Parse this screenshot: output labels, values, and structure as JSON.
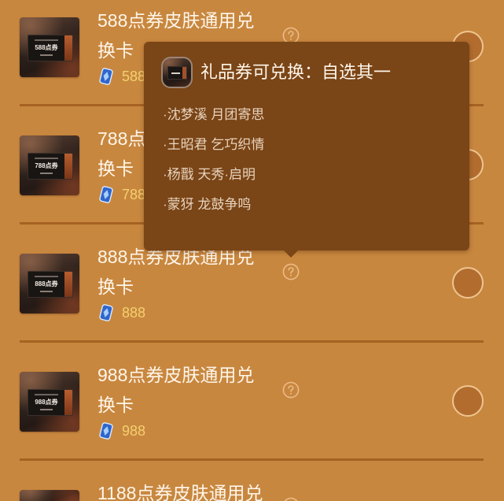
{
  "colors": {
    "background": "#C8873F",
    "separator": "#A66222",
    "tooltip_bg": "#7A4517",
    "title_text": "#FFF6EA",
    "option_text": "#E8D4BE",
    "price_text": "#F3D06F",
    "help_icon": "#EBBB85",
    "radio_fill": "#B26D2E",
    "radio_ring": "#EEC590",
    "gem_blue": "#2F66CC"
  },
  "icons": {
    "price": "voucher-gem-icon",
    "help": "question-circle-icon",
    "select": "radio-button"
  },
  "items": [
    {
      "title_line1": "588点券皮肤通用兑",
      "title_line2": "换卡",
      "price": "588",
      "thumb_label": "588点券",
      "selected": false
    },
    {
      "title_line1": "788点",
      "title_line2": "换卡",
      "price": "788",
      "thumb_label": "788点券",
      "selected": false
    },
    {
      "title_line1": "888点券皮肤通用兑",
      "title_line2": "换卡",
      "price": "888",
      "thumb_label": "888点券",
      "selected": false
    },
    {
      "title_line1": "988点券皮肤通用兑",
      "title_line2": "换卡",
      "price": "988",
      "thumb_label": "988点券",
      "selected": false
    },
    {
      "title_line1": "1188点券皮肤通用兑"
    }
  ],
  "tooltip": {
    "title": "礼品券可兑换：自选其一",
    "options": [
      "·沈梦溪 月团寄思",
      "·王昭君 乞巧织情",
      "·杨戬 天秀·启明",
      "·蒙犽 龙鼓争鸣"
    ]
  }
}
